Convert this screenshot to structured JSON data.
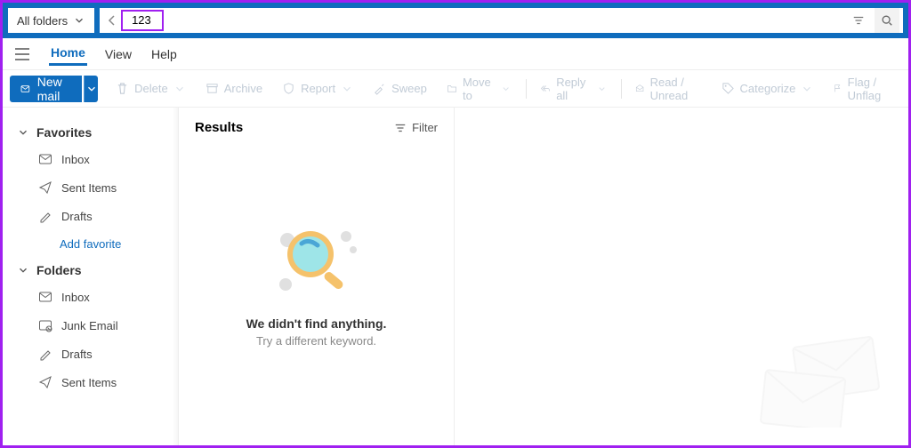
{
  "topbar": {
    "folder_select": "All folders",
    "search_value": "123"
  },
  "menu": {
    "tabs": [
      "Home",
      "View",
      "Help"
    ],
    "active": 0
  },
  "toolbar": {
    "new_mail": "New mail",
    "delete": "Delete",
    "archive": "Archive",
    "report": "Report",
    "sweep": "Sweep",
    "move_to": "Move to",
    "reply_all": "Reply all",
    "read_unread": "Read / Unread",
    "categorize": "Categorize",
    "flag": "Flag / Unflag"
  },
  "sidebar": {
    "favorites_label": "Favorites",
    "folders_label": "Folders",
    "add_favorite": "Add favorite",
    "favorites": [
      {
        "label": "Inbox",
        "icon": "inbox-icon"
      },
      {
        "label": "Sent Items",
        "icon": "sent-icon"
      },
      {
        "label": "Drafts",
        "icon": "drafts-icon"
      }
    ],
    "folders": [
      {
        "label": "Inbox",
        "icon": "inbox-icon"
      },
      {
        "label": "Junk Email",
        "icon": "junk-icon"
      },
      {
        "label": "Drafts",
        "icon": "drafts-icon"
      },
      {
        "label": "Sent Items",
        "icon": "sent-icon"
      }
    ]
  },
  "results": {
    "header": "Results",
    "filter": "Filter",
    "empty_title": "We didn't find anything.",
    "empty_sub": "Try a different keyword."
  }
}
